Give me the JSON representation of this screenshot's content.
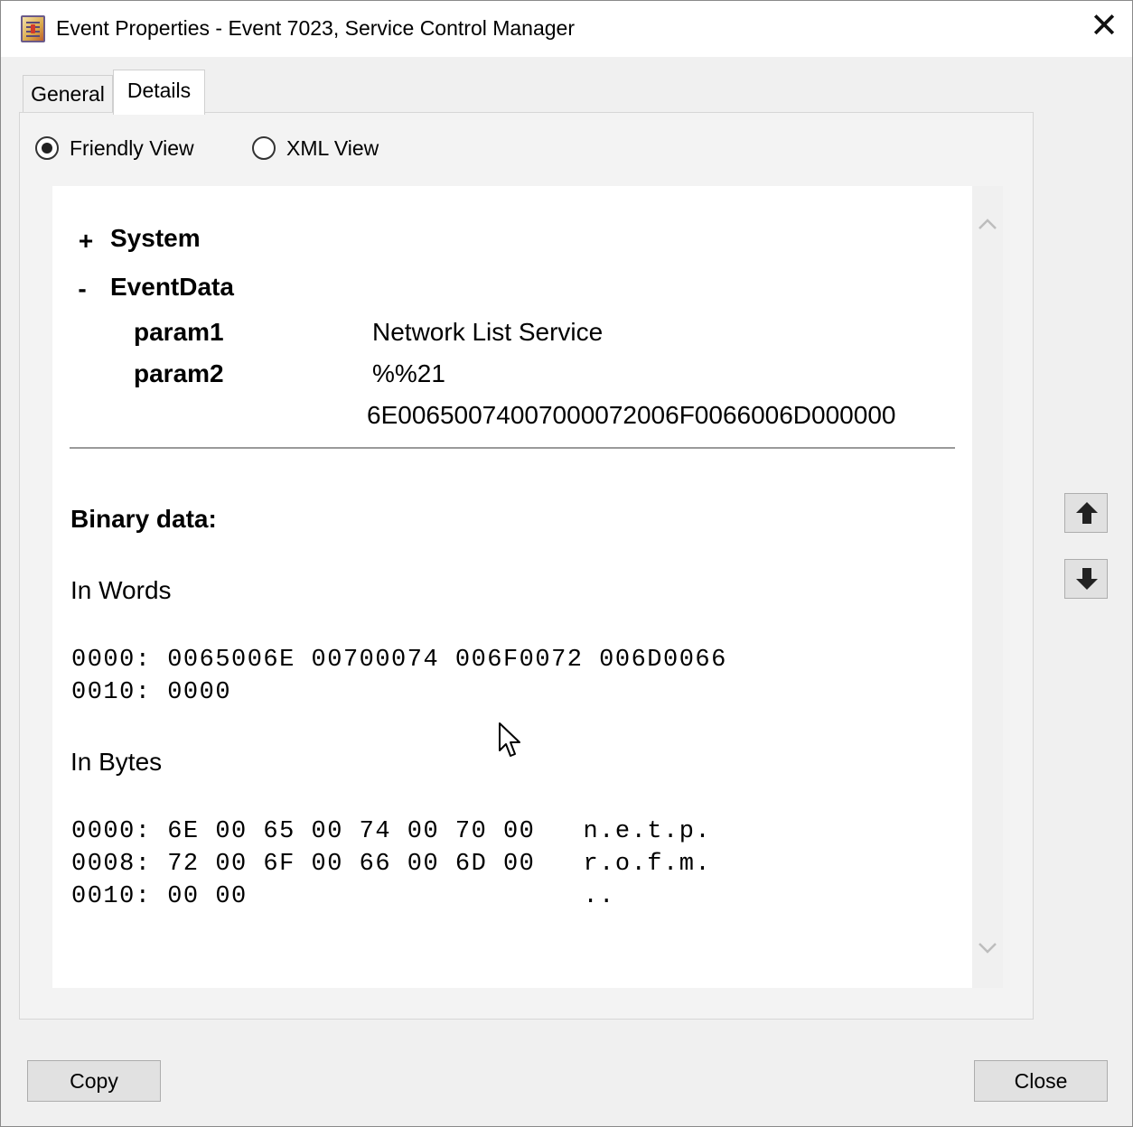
{
  "window": {
    "title": "Event Properties - Event 7023, Service Control Manager",
    "close_glyph": "✕"
  },
  "tabs": [
    {
      "label": "General",
      "selected": false
    },
    {
      "label": "Details",
      "selected": true
    }
  ],
  "view_options": {
    "friendly": {
      "label": "Friendly View",
      "checked": true
    },
    "xml": {
      "label": "XML View",
      "checked": false
    }
  },
  "details": {
    "system": {
      "toggle": "+",
      "label": "System"
    },
    "event_data": {
      "toggle": "-",
      "label": "EventData"
    },
    "params": [
      {
        "name": "param1",
        "value": "Network List Service"
      },
      {
        "name": "param2",
        "value": "%%21"
      }
    ],
    "extra_value": "6E00650074007000072006F0066006D000000",
    "binary_title": "Binary data:",
    "in_words_title": "In Words",
    "in_words_lines": [
      "0000: 0065006E 00700074 006F0072 006D0066",
      "0010: 0000"
    ],
    "in_bytes_title": "In Bytes",
    "in_bytes_lines": [
      "0000: 6E 00 65 00 74 00 70 00   n.e.t.p.",
      "0008: 72 00 6F 00 66 00 6D 00   r.o.f.m.",
      "0010: 00 00                     .."
    ]
  },
  "buttons": {
    "copy": "Copy",
    "close": "Close"
  },
  "icons": {
    "app": "event-viewer-icon",
    "up_arrow": "arrow-up-icon",
    "down_arrow": "arrow-down-icon",
    "scroll_up": "chevron-up-icon",
    "scroll_down": "chevron-down-icon"
  }
}
